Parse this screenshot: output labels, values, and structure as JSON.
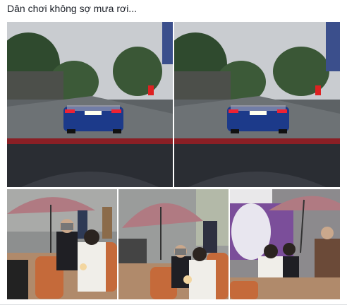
{
  "post": {
    "caption": "Dân chơi không sợ mưa rơi..."
  },
  "photos": [
    {
      "name": "dashboard-view-left",
      "icon": "photo-icon"
    },
    {
      "name": "dashboard-view-right",
      "icon": "photo-icon"
    },
    {
      "name": "couple-umbrella-left",
      "icon": "photo-icon"
    },
    {
      "name": "couple-umbrella-middle",
      "icon": "photo-icon"
    },
    {
      "name": "couple-umbrella-right",
      "icon": "photo-icon"
    }
  ],
  "colors": {
    "caption_text": "#1d2129",
    "umbrella": "#b07a82",
    "car_blue": "#1c3a8a",
    "dashboard": "#2a2d33",
    "sky": "#c9ccd0"
  }
}
